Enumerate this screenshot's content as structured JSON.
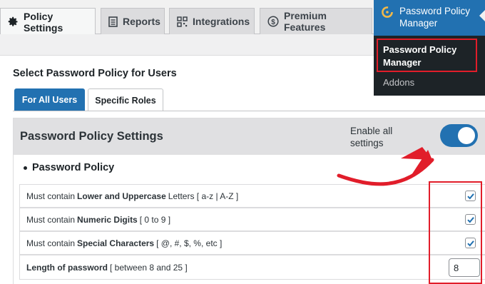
{
  "tabs": [
    {
      "label": "Policy Settings",
      "icon": "gear-icon",
      "active": true
    },
    {
      "label": "Reports",
      "icon": "document-icon",
      "active": false
    },
    {
      "label": "Integrations",
      "icon": "grid-icon",
      "active": false
    },
    {
      "label": "Premium Features",
      "icon": "dollar-icon",
      "active": false
    }
  ],
  "main": {
    "section_title": "Select Password Policy for Users",
    "subtabs": [
      "For All Users",
      "Specific Roles"
    ],
    "settings_title": "Password Policy Settings",
    "enable_all_label": "Enable all settings",
    "enable_all_on": true,
    "policy_heading": "Password Policy",
    "rows": [
      {
        "prefix": "Must contain",
        "bold": "Lower and Uppercase",
        "suffix": "Letters [ a-z | A-Z ]",
        "checked": true
      },
      {
        "prefix": "Must contain",
        "bold": "Numeric Digits",
        "suffix": "[ 0 to 9 ]",
        "checked": true
      },
      {
        "prefix": "Must contain",
        "bold": "Special Characters",
        "suffix": "[ @, #, $, %, etc ]",
        "checked": true
      },
      {
        "prefix": "",
        "bold": "Length of password",
        "suffix": "[ between 8 and 25 ]",
        "value": "8"
      }
    ]
  },
  "wp_menu": {
    "top_label": "Password Policy Manager",
    "active_item": "Password Policy Manager",
    "item": "Addons"
  },
  "colors": {
    "accent": "#2271b1",
    "highlight": "#e11d2a",
    "admin_bar": "#1d2327"
  }
}
